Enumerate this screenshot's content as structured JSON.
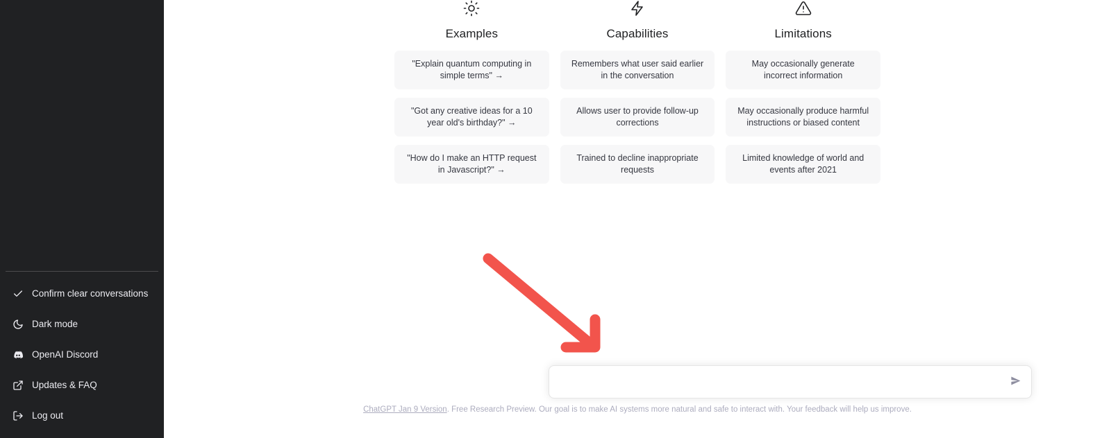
{
  "sidebar": {
    "menu": [
      {
        "label": "Confirm clear conversations",
        "icon": "check-icon",
        "name": "confirm-clear-conversations"
      },
      {
        "label": "Dark mode",
        "icon": "moon-icon",
        "name": "dark-mode"
      },
      {
        "label": "OpenAI Discord",
        "icon": "discord-icon",
        "name": "openai-discord"
      },
      {
        "label": "Updates & FAQ",
        "icon": "external-link-icon",
        "name": "updates-and-faq"
      },
      {
        "label": "Log out",
        "icon": "logout-icon",
        "name": "log-out"
      }
    ]
  },
  "intro": {
    "columns": [
      {
        "title": "Examples",
        "icon": "sun-icon",
        "cards": [
          "\"Explain quantum computing in simple terms\" →",
          "\"Got any creative ideas for a 10 year old's birthday?\" →",
          "\"How do I make an HTTP request in Javascript?\" →"
        ]
      },
      {
        "title": "Capabilities",
        "icon": "lightning-icon",
        "cards": [
          "Remembers what user said earlier in the conversation",
          "Allows user to provide follow-up corrections",
          "Trained to decline inappropriate requests"
        ]
      },
      {
        "title": "Limitations",
        "icon": "warning-icon",
        "cards": [
          "May occasionally generate incorrect information",
          "May occasionally produce harmful instructions or biased content",
          "Limited knowledge of world and events after 2021"
        ]
      }
    ]
  },
  "composer": {
    "value": "",
    "placeholder": "",
    "send_icon": "send-icon"
  },
  "footer": {
    "link_text": "ChatGPT Jan 9 Version",
    "rest_text": ". Free Research Preview. Our goal is to make AI systems more natural and safe to interact with. Your feedback will help us improve."
  },
  "annotation": {
    "arrow_color": "#f2544c"
  }
}
